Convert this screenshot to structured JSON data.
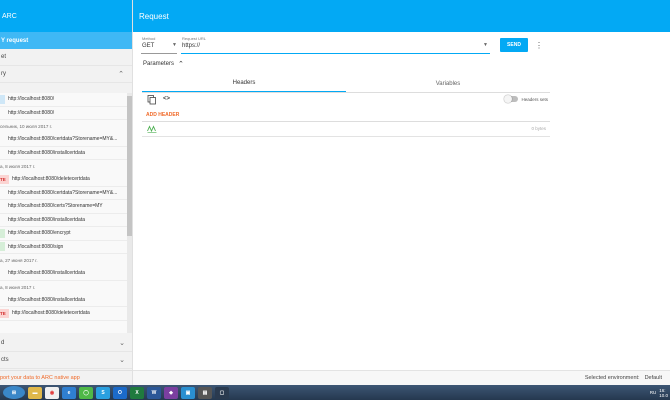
{
  "sidebar": {
    "title": "ARC",
    "new_request": "Y request",
    "row_saved": "et",
    "row_history": "ry",
    "history": [
      {
        "type": "item",
        "method": "GET",
        "badge": "",
        "url": "http://localhost:8080/"
      },
      {
        "type": "item",
        "method": "",
        "badge": "",
        "url": "http://localhost:8080/"
      },
      {
        "type": "date",
        "text": "сельник, 10 июля 2017 г."
      },
      {
        "type": "item",
        "method": "",
        "badge": "",
        "url": "http://localhost:8080/certdata?Storename=MY&..."
      },
      {
        "type": "item",
        "method": "",
        "badge": "",
        "url": "http://localhost:8080/installcertdata"
      },
      {
        "type": "date",
        "text": "а, 8 июля 2017 г."
      },
      {
        "type": "item",
        "method": "DELETE",
        "badge": "TE",
        "url": "http://localhost:8080/deletecertdata"
      },
      {
        "type": "item",
        "method": "",
        "badge": "",
        "url": "http://localhost:8080/certdata?Storename=MY&..."
      },
      {
        "type": "item",
        "method": "",
        "badge": "",
        "url": "http://localhost:8080/certs?Storename=MY"
      },
      {
        "type": "item",
        "method": "",
        "badge": "",
        "url": "http://localhost:8080/installcertdata"
      },
      {
        "type": "item",
        "method": "POST",
        "badge": "",
        "url": "http://localhost:8080/encrypt"
      },
      {
        "type": "item",
        "method": "POST",
        "badge": "",
        "url": "http://localhost:8080/sign"
      },
      {
        "type": "date",
        "text": "а, 27 июня 2017 г."
      },
      {
        "type": "item",
        "method": "",
        "badge": "",
        "url": "http://localhost:8080/installcertdata"
      },
      {
        "type": "date",
        "text": "а, 8 июня 2017 г."
      },
      {
        "type": "item",
        "method": "",
        "badge": "",
        "url": "http://localhost:8080/installcertdata"
      },
      {
        "type": "item",
        "method": "DELETE",
        "badge": "TE",
        "url": "http://localhost:8080/deletecertdata"
      }
    ],
    "row_bottom1": "d",
    "row_bottom2": "cts",
    "footer": "port your data to ARC native app"
  },
  "main": {
    "title": "Request",
    "method_label": "Method",
    "method_value": "GET",
    "url_label": "Request URL",
    "url_value": "https://",
    "send_label": "SEND",
    "more_label": "⋮",
    "parameters_label": "Parameters",
    "tabs": [
      {
        "label": "Headers",
        "active": true
      },
      {
        "label": "Variables",
        "active": false
      }
    ],
    "headers_sets_label": "Headers sets",
    "add_header_label": "ADD HEADER",
    "size_label": "0 bytes",
    "selected_env_label": "Selected environment:",
    "selected_env_value": "Default"
  },
  "taskbar": {
    "lang": "RU",
    "time": "16:",
    "date": "10.0"
  },
  "colors": {
    "accent": "#03a9f4",
    "add_header": "#f06a29",
    "delete": "#d32f2f"
  }
}
